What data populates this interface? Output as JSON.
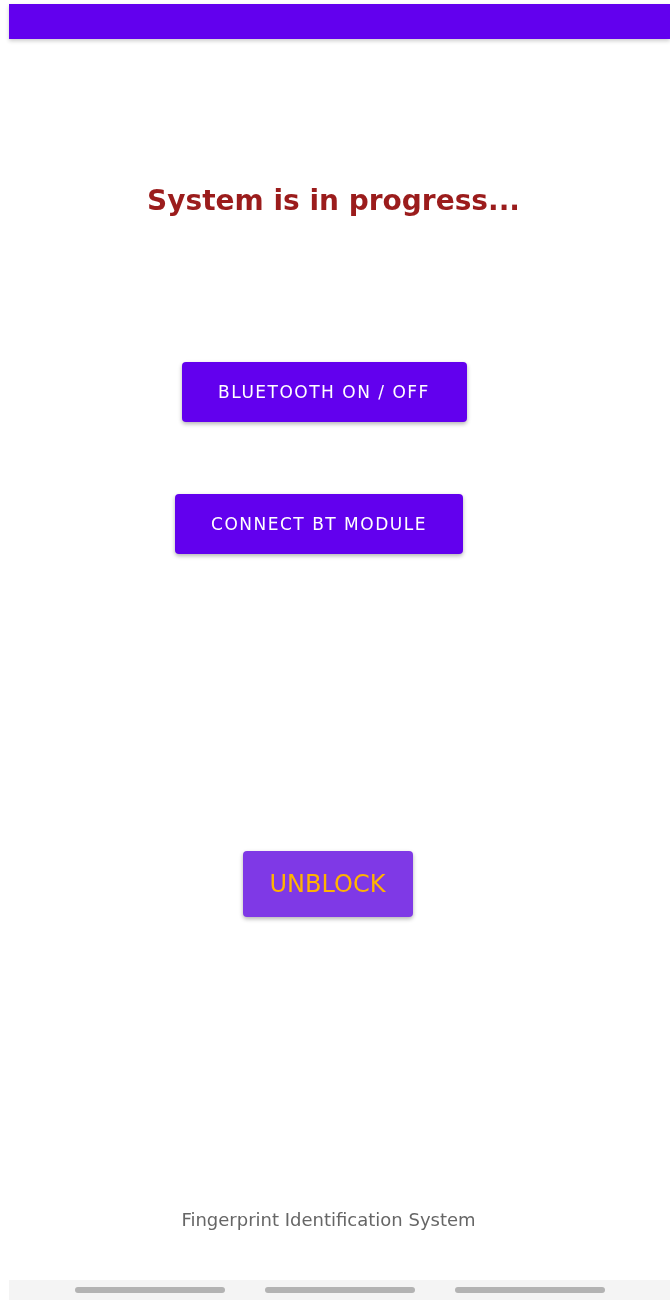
{
  "title": "System is in progress...",
  "buttons": [
    {
      "label": "BLUETOOTH ON / OFF",
      "kind": "primary"
    },
    {
      "label": "CONNECT BT MODULE",
      "kind": "primary"
    },
    {
      "label": "UNBLOCK",
      "kind": "accent"
    }
  ],
  "footer": "Fingerprint Identification System"
}
